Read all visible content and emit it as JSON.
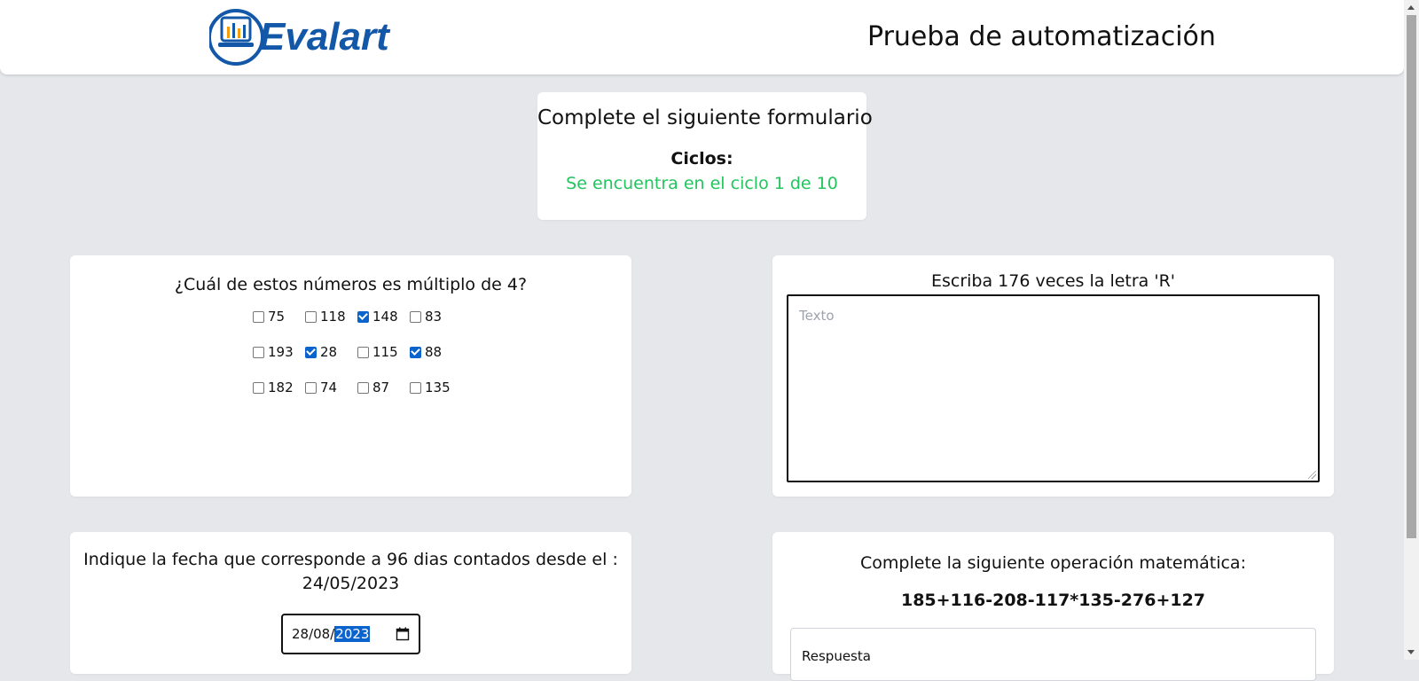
{
  "header": {
    "logo_text": "Evalart",
    "title": "Prueba de automatización",
    "brand_color": "#1257a8"
  },
  "cycles": {
    "heading": "Complete el siguiente formulario",
    "label": "Ciclos:",
    "status": "Se encuentra en el ciclo 1 de 10",
    "status_color": "#22c55e"
  },
  "multiple_question": {
    "title": "¿Cuál de estos números es múltiplo de 4?",
    "options": [
      {
        "label": "75",
        "checked": false
      },
      {
        "label": "118",
        "checked": false
      },
      {
        "label": "148",
        "checked": true
      },
      {
        "label": "83",
        "checked": false
      },
      {
        "label": "193",
        "checked": false
      },
      {
        "label": "28",
        "checked": true
      },
      {
        "label": "115",
        "checked": false
      },
      {
        "label": "88",
        "checked": true
      },
      {
        "label": "182",
        "checked": false
      },
      {
        "label": "74",
        "checked": false
      },
      {
        "label": "87",
        "checked": false
      },
      {
        "label": "135",
        "checked": false
      }
    ]
  },
  "text_question": {
    "title": "Escriba 176 veces la letra 'R'",
    "placeholder": "Texto",
    "value": ""
  },
  "date_question": {
    "line1": "Indique la fecha que corresponde a 96 dias contados desde el :",
    "line2": "24/05/2023",
    "value_day_month": "28/08/",
    "value_year": "2023",
    "icon": "calendar-icon"
  },
  "math_question": {
    "title": "Complete la siguiente operación matemática:",
    "expression": "185+116-208-117*135-276+127",
    "placeholder": "Respuesta"
  }
}
